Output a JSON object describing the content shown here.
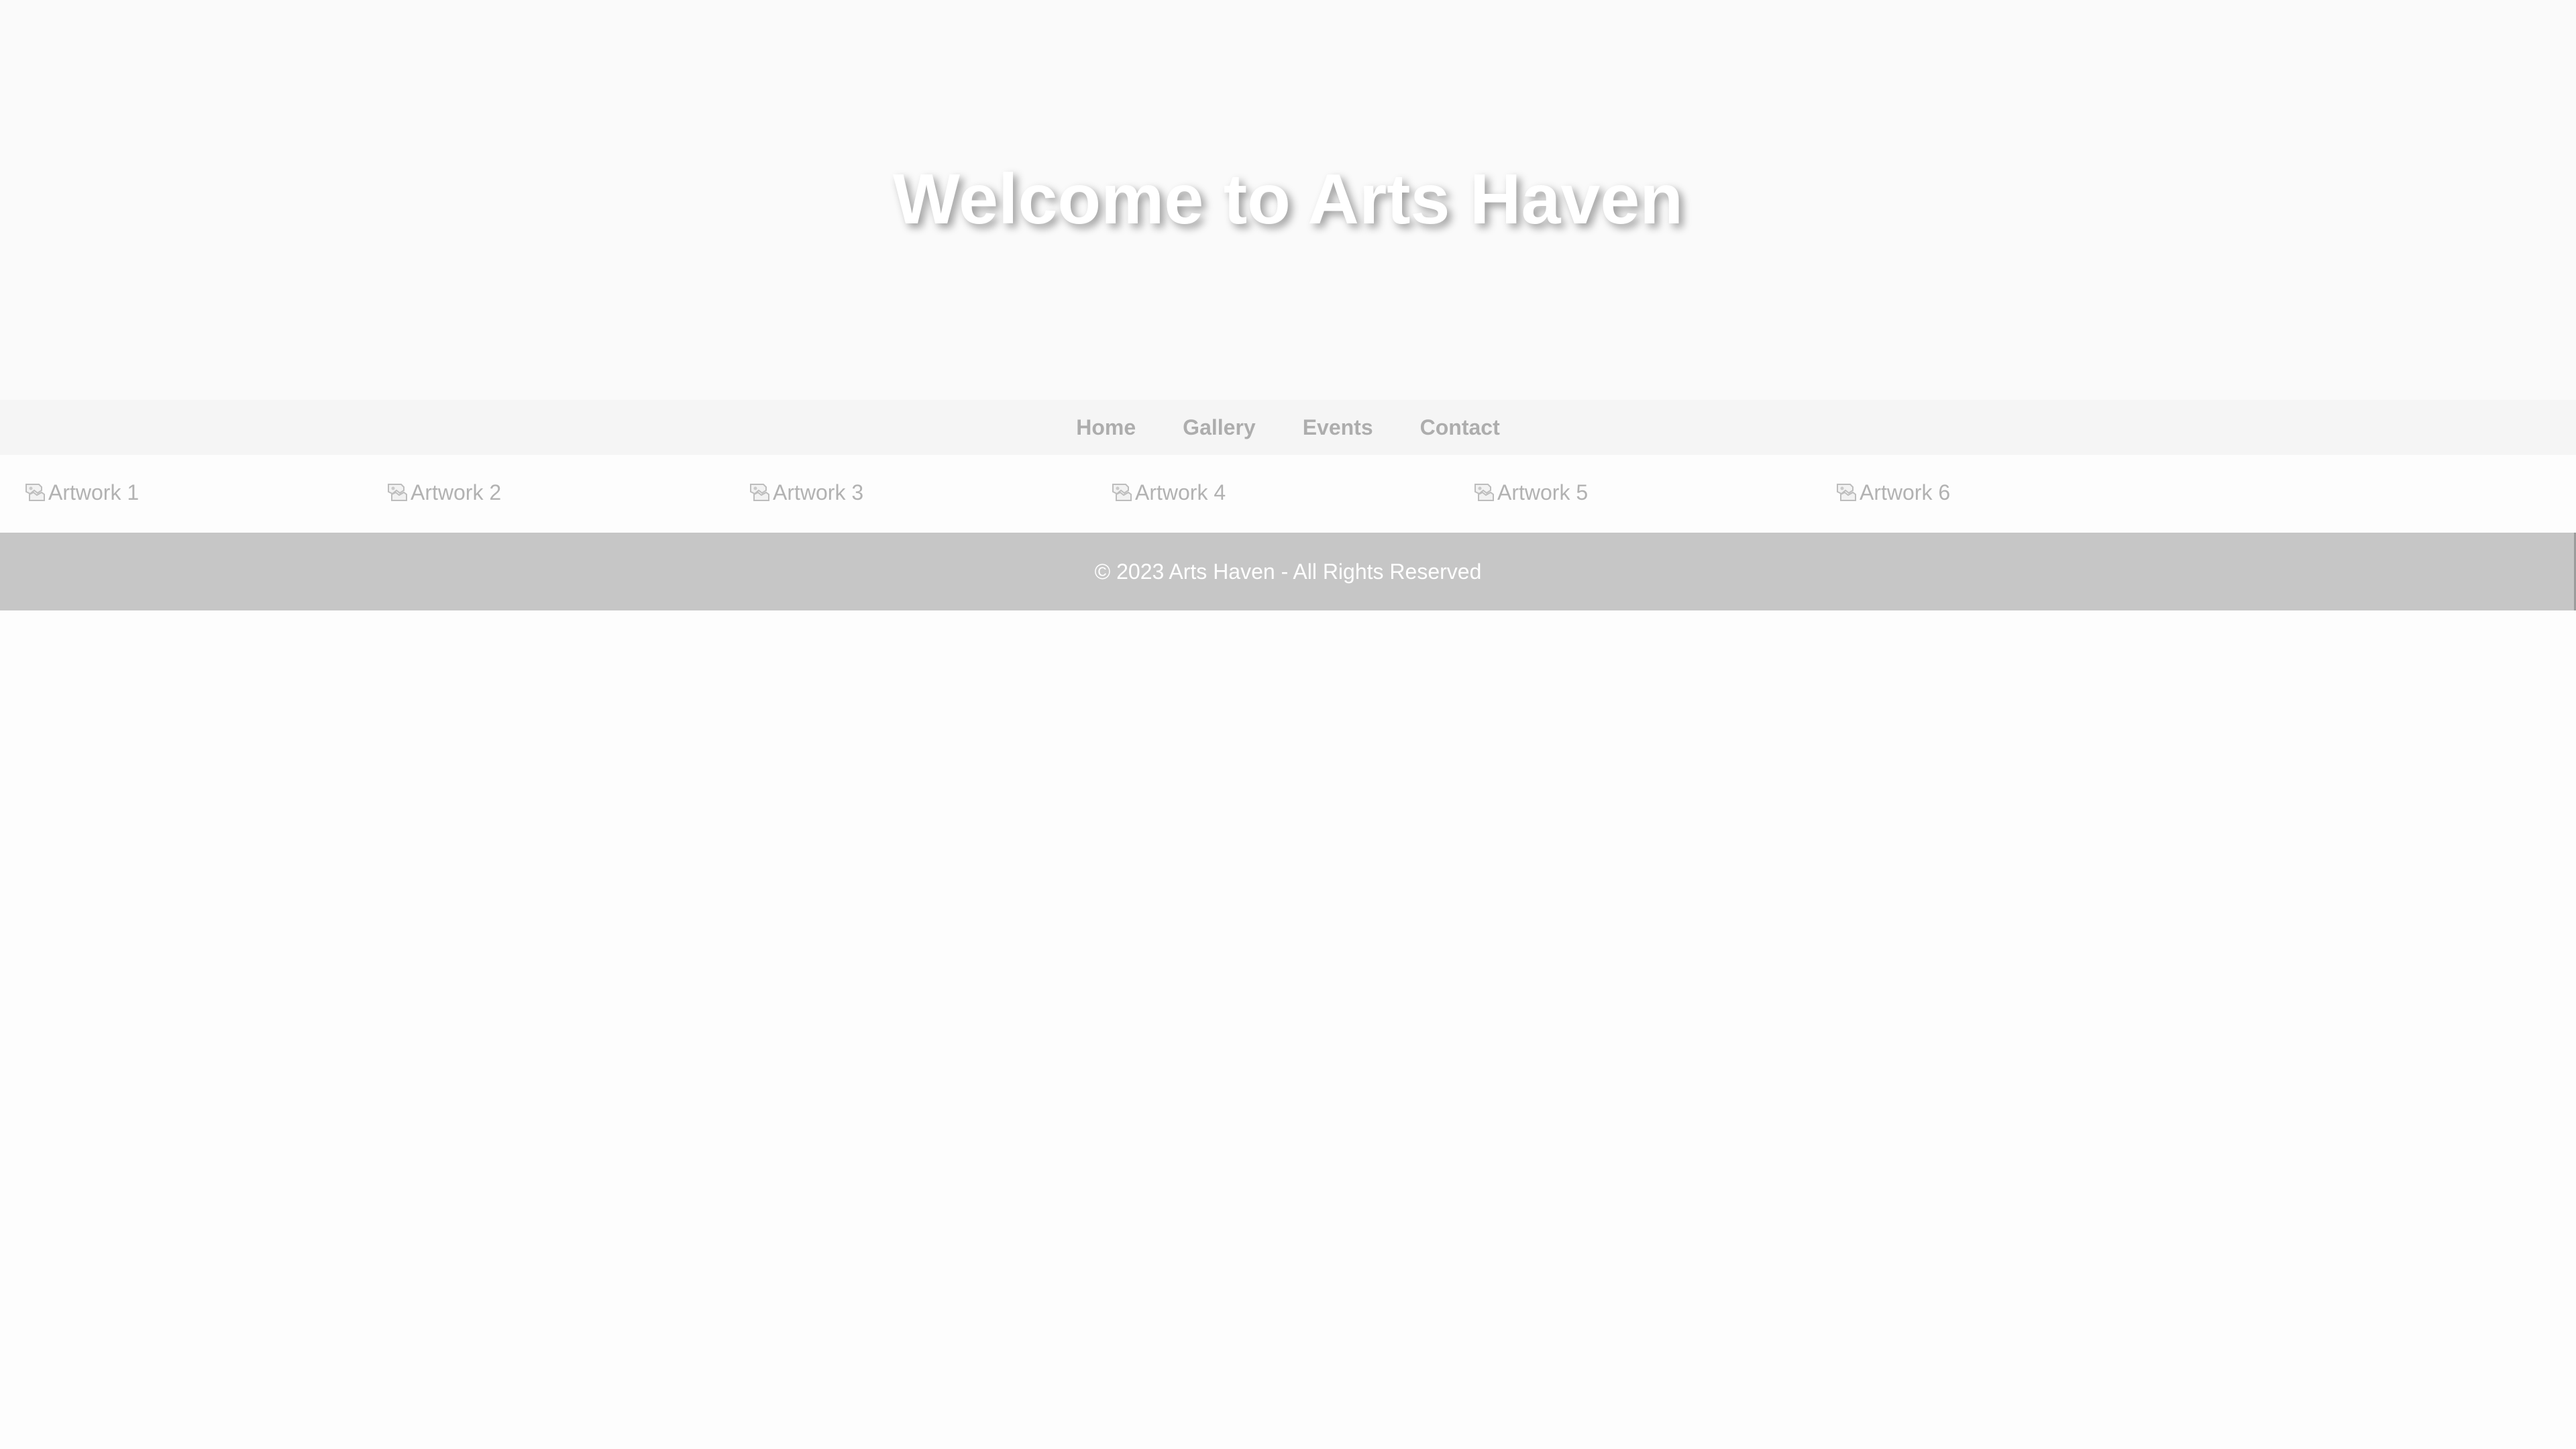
{
  "hero": {
    "title": "Welcome to Arts Haven"
  },
  "nav": {
    "items": [
      {
        "label": "Home"
      },
      {
        "label": "Gallery"
      },
      {
        "label": "Events"
      },
      {
        "label": "Contact"
      }
    ]
  },
  "gallery": {
    "items": [
      {
        "alt": "Artwork 1",
        "icon": "broken-image-icon"
      },
      {
        "alt": "Artwork 2",
        "icon": "broken-image-icon"
      },
      {
        "alt": "Artwork 3",
        "icon": "broken-image-icon"
      },
      {
        "alt": "Artwork 4",
        "icon": "broken-image-icon"
      },
      {
        "alt": "Artwork 5",
        "icon": "broken-image-icon"
      },
      {
        "alt": "Artwork 6",
        "icon": "broken-image-icon"
      }
    ]
  },
  "footer": {
    "text": "© 2023 Arts Haven - All Rights Reserved"
  },
  "colors": {
    "footer_bg": "#c6c6c6",
    "nav_text": "#adadad",
    "hero_text": "#ffffff"
  }
}
